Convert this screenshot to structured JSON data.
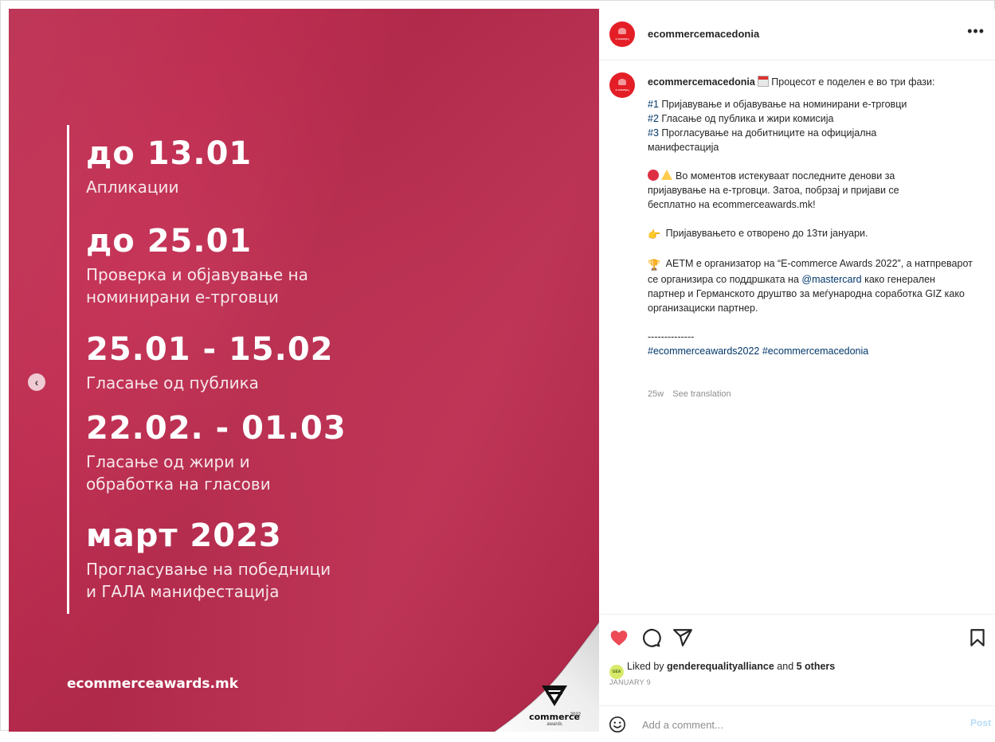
{
  "image": {
    "phases": [
      {
        "date": "до 13.01",
        "desc_lines": [
          "Апликации"
        ]
      },
      {
        "date": "до 25.01",
        "desc_lines": [
          "Проверка и објавување на",
          "номинирани е-трговци"
        ]
      },
      {
        "date": "25.01 - 15.02",
        "desc_lines": [
          "Гласање од публика"
        ]
      },
      {
        "date": "22.02. - 01.03",
        "desc_lines": [
          "Гласање од жири и",
          "обработка на гласови"
        ]
      },
      {
        "date": "март 2023",
        "desc_lines": [
          "Прогласување на победници",
          "и ГАЛА манифестација"
        ]
      }
    ],
    "site_url": "ecommerceawards.mk",
    "logo_word": "commerce",
    "logo_sub": "awards",
    "logo_year": "2022",
    "prev_glyph": "‹",
    "slide_count": 2,
    "active_slide": 2
  },
  "header": {
    "username": "ecommercemacedonia",
    "more_glyph": "•••",
    "avatar_text": "e-комерц"
  },
  "caption": {
    "author": "ecommercemacedonia",
    "intro": "Процесот е поделен е во три фази:",
    "phase1_tag": "#1",
    "phase1_text": " Пријавување и објавување на номинирани е-трговци",
    "phase2_tag": "#2",
    "phase2_text": " Гласање од публика и жири комисија",
    "phase3_tag": "#3",
    "phase3_text": " Прогласување на добитниците на официјална манифестација",
    "warning_text": "Во моментов истекуваат последните денови за пријавување на е-трговци. Затоа, побрзај и пријави се бесплатно на ecommerceawards.mk!",
    "open_text": "Пријавувањето е отворено до 13ти јануари.",
    "org_text_1": "АЕТМ е организатор на “E-commerce Awards 2022”, а натпреварот се организира со поддршката на ",
    "mention": "@mastercard",
    "org_text_2": " како генерален партнер и Германското друштво за меѓународна соработка GIZ како организациски партнер.",
    "divider": "--------------",
    "hashtag1": "#ecommerceawards2022",
    "hashtag2": "#ecommercemacedonia",
    "hand_glyph": "👉",
    "trophy_glyph": "🏆"
  },
  "meta": {
    "age": "25w",
    "see_translation": "See translation"
  },
  "actions": {
    "liked_by_prefix": "Liked by ",
    "liked_by_user": "genderequalityalliance",
    "liked_by_and": " and ",
    "liked_by_others": "5 others",
    "date": "JANUARY 9",
    "mini_avatar_text": "GEA"
  },
  "comment": {
    "placeholder": "Add a comment...",
    "post_label": "Post"
  },
  "colors": {
    "brand_red": "#bd2e51",
    "like_red": "#ed4956",
    "link_blue": "#00376b"
  }
}
